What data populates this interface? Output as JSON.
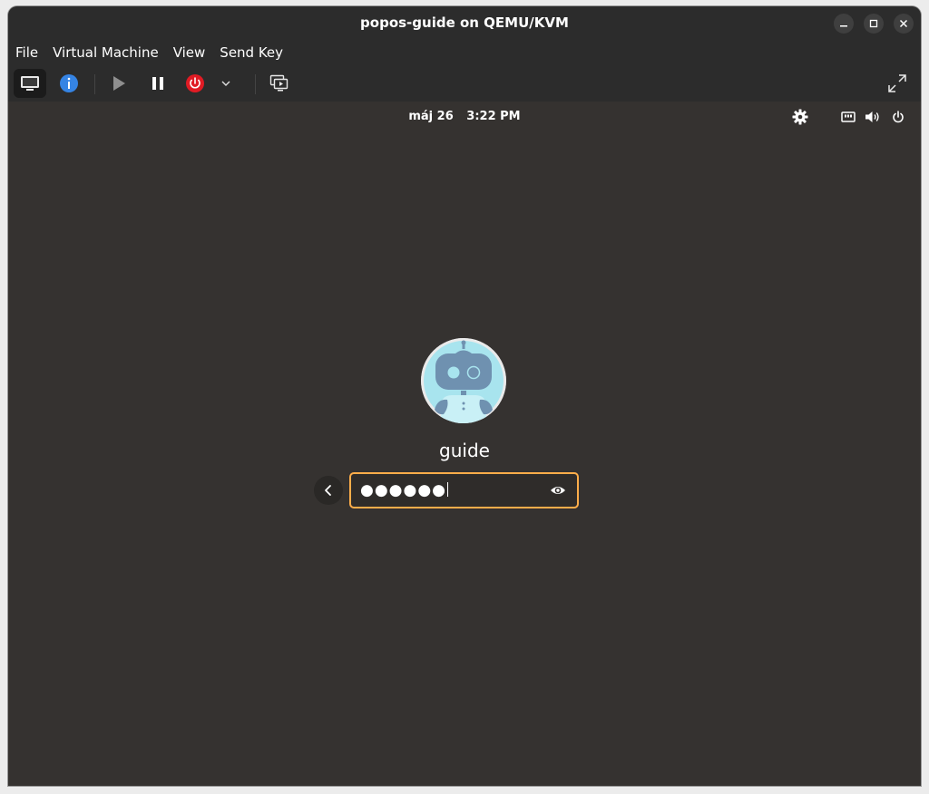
{
  "window": {
    "title": "popos-guide on QEMU/KVM"
  },
  "menubar": {
    "items": [
      "File",
      "Virtual Machine",
      "View",
      "Send Key"
    ]
  },
  "toolbar": {
    "buttons": [
      "console-icon",
      "info-icon",
      "play-icon",
      "pause-icon",
      "power-icon",
      "chevron-down-icon",
      "snapshots-icon",
      "fullscreen-icon"
    ]
  },
  "guest": {
    "topbar": {
      "date": "máj 26",
      "time": "3:22 PM"
    },
    "login": {
      "username": "guide",
      "password_masked": "●●●●●●"
    },
    "colors": {
      "background": "#353230",
      "focus_border": "#ffad4a",
      "power_red": "#e01b24",
      "info_blue": "#3584e4",
      "avatar_bg": "#a8e4ee"
    }
  }
}
